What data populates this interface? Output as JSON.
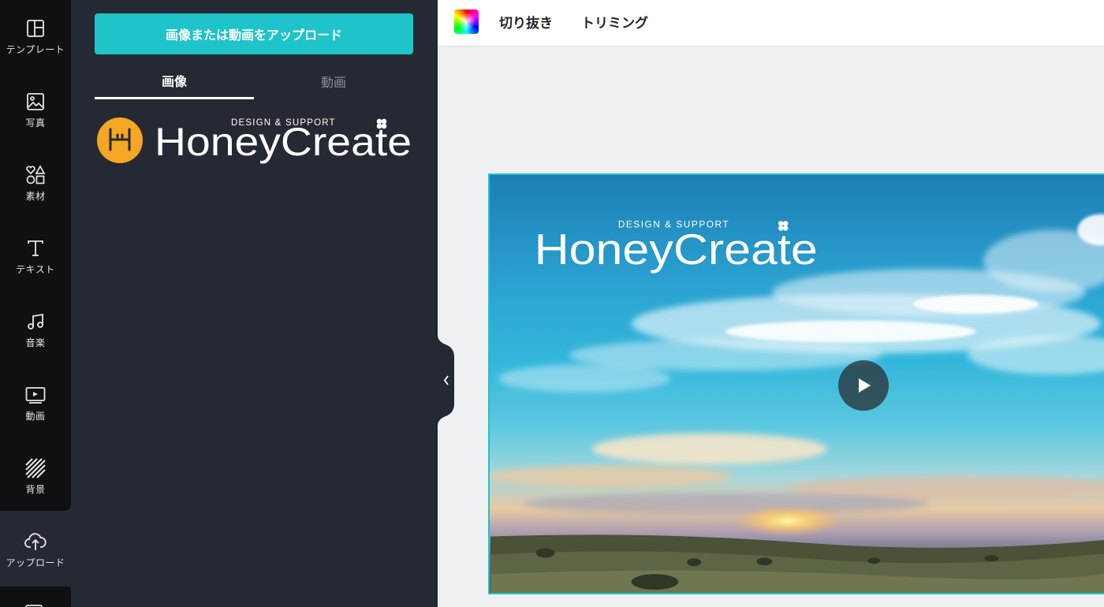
{
  "rail": {
    "items": [
      {
        "label": "テンプレート",
        "icon": "layout-icon"
      },
      {
        "label": "写真",
        "icon": "photo-icon"
      },
      {
        "label": "素材",
        "icon": "elements-icon"
      },
      {
        "label": "テキスト",
        "icon": "text-icon"
      },
      {
        "label": "音楽",
        "icon": "music-icon"
      },
      {
        "label": "動画",
        "icon": "video-icon"
      },
      {
        "label": "背景",
        "icon": "background-icon"
      },
      {
        "label": "アップロード",
        "icon": "upload-cloud-icon"
      }
    ],
    "active": "アップロード"
  },
  "panel": {
    "upload_button": "画像または動画をアップロード",
    "tabs": [
      "画像",
      "動画"
    ],
    "active_tab": "画像",
    "thumbnail": {
      "logo_tagline": "DESIGN & SUPPORT",
      "logo_name": "HoneyCreate",
      "badge_color": "#f5a623"
    }
  },
  "toolbar": {
    "crop_label": "切り抜き",
    "trim_label": "トリミング"
  },
  "canvas": {
    "logo_tagline": "DESIGN & SUPPORT",
    "logo_name": "HoneyCreate",
    "media_type": "video",
    "accent": "#1ec4c9"
  }
}
